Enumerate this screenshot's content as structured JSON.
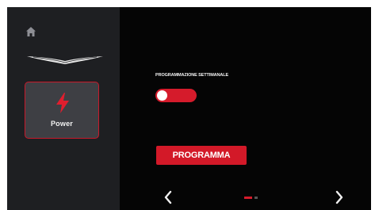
{
  "sidebar": {
    "home_icon": "home-icon",
    "logo_icon": "winged-logo-icon",
    "power_tile": {
      "label": "Power",
      "icon": "lightning-bolt-icon",
      "selected": true
    }
  },
  "main": {
    "schedule_label": "PROGRAMMAZIONE SETTIMANALE",
    "toggle": {
      "on": false
    },
    "program_button_label": "PROGRAMMA"
  },
  "pager": {
    "prev_icon": "chevron-left-icon",
    "next_icon": "chevron-right-icon",
    "current_page": 1,
    "total_pages": 2
  },
  "colors": {
    "accent": "#d51b2b",
    "background": "#050505",
    "sidebar": "#1e1f22",
    "tile": "#3e3f44"
  }
}
